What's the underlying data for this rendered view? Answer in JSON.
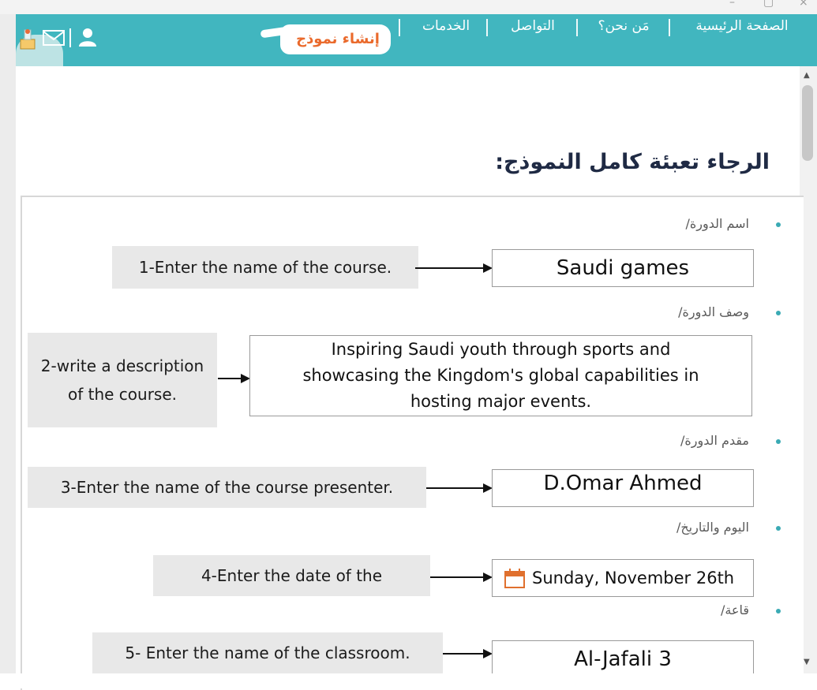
{
  "window": {
    "minimize_glyph": "–",
    "maximize_glyph": "▢",
    "close_glyph": "×"
  },
  "nav": {
    "items": [
      {
        "label": "الصفحة الرئيسية"
      },
      {
        "label": "مَن نحن؟"
      },
      {
        "label": "التواصل"
      },
      {
        "label": "الخدمات"
      }
    ],
    "create_label": "إنشاء نموذج",
    "icons": [
      "mail-icon",
      "user-icon",
      "certificate-icon"
    ],
    "accent_color": "#41b6bf",
    "create_color": "#ea6a2c"
  },
  "heading": "الرجاء تعبئة كامل النموذج:",
  "form": {
    "fields": [
      {
        "label_ar": "اسم الدورة/",
        "instruction": "1-Enter the name of the course.",
        "value": "Saudi games"
      },
      {
        "label_ar": "وصف الدورة/",
        "instruction": "2-write a description of the course.",
        "value": "Inspiring Saudi youth through sports and showcasing the Kingdom's global capabilities in hosting major events."
      },
      {
        "label_ar": "مقدم الدورة/",
        "instruction": "3-Enter the name of the course presenter.",
        "value": "D.Omar Ahmed"
      },
      {
        "label_ar": "اليوم والتاريخ/",
        "instruction": "4-Enter the date of the",
        "value": "Sunday, November 26th"
      },
      {
        "label_ar": "قاعة/",
        "instruction": "5- Enter the name of the classroom.",
        "value": "Al-Jafali 3"
      }
    ]
  }
}
